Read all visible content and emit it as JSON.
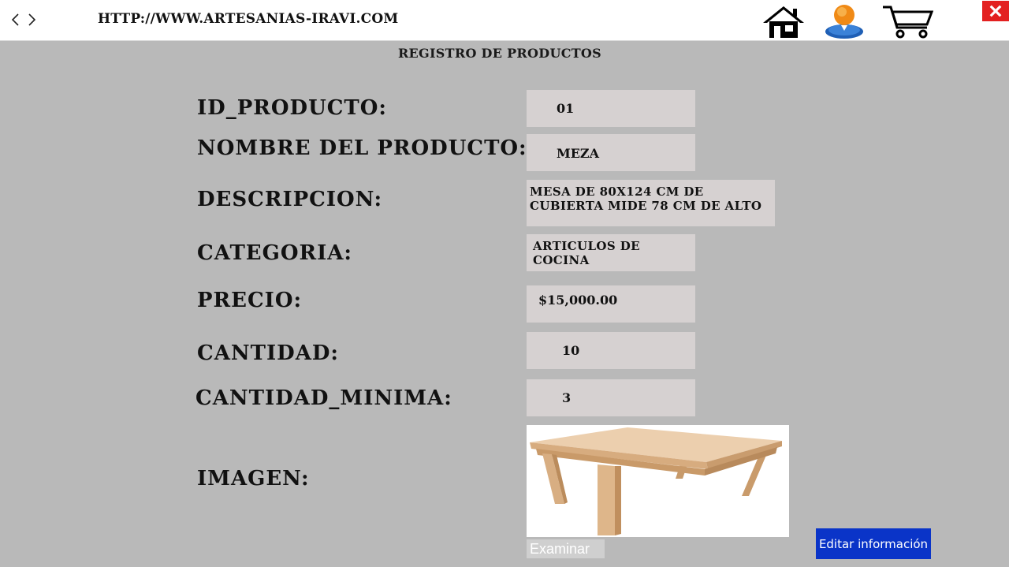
{
  "browser": {
    "url": "HTTP://WWW.ARTESANIAS-IRAVI.COM",
    "back_icon": "chevron-left-icon",
    "forward_icon": "chevron-right-icon",
    "home_icon": "home-icon",
    "user_icon": "user-icon",
    "cart_icon": "cart-icon",
    "close_icon": "close-icon"
  },
  "page": {
    "title": "REGISTRO DE PRODUCTOS"
  },
  "form": {
    "id_label": "ID_PRODUCTO:",
    "id_value": "01",
    "name_label": "NOMBRE DEL PRODUCTO:",
    "name_value": "MEZA",
    "description_label": "DESCRIPCION:",
    "description_value": "MESA DE 80X124 CM DE CUBIERTA MIDE 78 CM DE ALTO",
    "category_label": "CATEGORIA:",
    "category_value": "ARTICULOS DE COCINA",
    "price_label": "PRECIO:",
    "price_value": "$15,000.00",
    "quantity_label": "CANTIDAD:",
    "quantity_value": "10",
    "min_quantity_label": "CANTIDAD_MINIMA:",
    "min_quantity_value": "3",
    "image_label": "IMAGEN:",
    "browse_label": "Examinar"
  },
  "actions": {
    "edit_label": "Editar información"
  },
  "colors": {
    "page_bg": "#b9b9b9",
    "field_bg": "#d6d1d1",
    "edit_button": "#0a34c8",
    "close_button": "#e32020"
  }
}
